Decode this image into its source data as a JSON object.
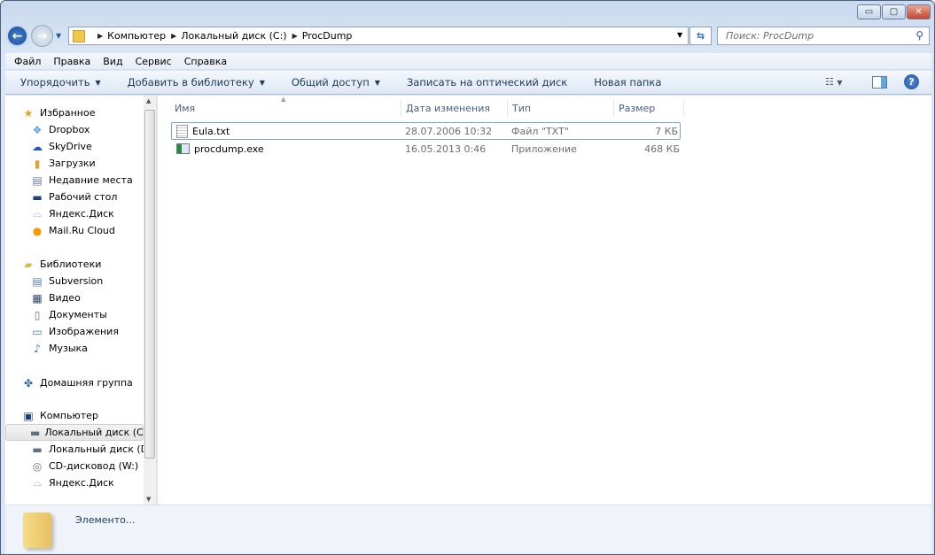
{
  "window": {
    "controls": {
      "minimize": "▭",
      "maximize": "▢",
      "close": "✕"
    }
  },
  "address": {
    "crumbs": [
      "Компьютер",
      "Локальный диск (C:)",
      "ProcDump"
    ],
    "search_placeholder": "Поиск: ProcDump"
  },
  "menu": [
    "Файл",
    "Правка",
    "Вид",
    "Сервис",
    "Справка"
  ],
  "toolbar": {
    "organize": "Упорядочить",
    "add_library": "Добавить в библиотеку",
    "share": "Общий доступ",
    "burn": "Записать на оптический диск",
    "new_folder": "Новая папка"
  },
  "nav": {
    "favorites": {
      "label": "Избранное",
      "items": [
        "Dropbox",
        "SkyDrive",
        "Загрузки",
        "Недавние места",
        "Рабочий стол",
        "Яндекс.Диск",
        "Mail.Ru Cloud"
      ]
    },
    "libraries": {
      "label": "Библиотеки",
      "items": [
        "Subversion",
        "Видео",
        "Документы",
        "Изображения",
        "Музыка"
      ]
    },
    "homegroup": {
      "label": "Домашняя группа"
    },
    "computer": {
      "label": "Компьютер",
      "items": [
        "Локальный диск (C:)",
        "Локальный диск (D:)",
        "CD-дисковод (W:)",
        "Яндекс.Диск"
      ],
      "selected": "Локальный диск (C:)"
    }
  },
  "columns": [
    "Имя",
    "Дата изменения",
    "Тип",
    "Размер"
  ],
  "files": [
    {
      "name": "Eula.txt",
      "date": "28.07.2006 10:32",
      "type": "Файл \"TXT\"",
      "size": "7 КБ",
      "icon": "text-file-icon"
    },
    {
      "name": "procdump.exe",
      "date": "16.05.2013 0:46",
      "type": "Приложение",
      "size": "468 КБ",
      "icon": "exe-file-icon"
    }
  ],
  "details": {
    "text": "Элементо..."
  }
}
